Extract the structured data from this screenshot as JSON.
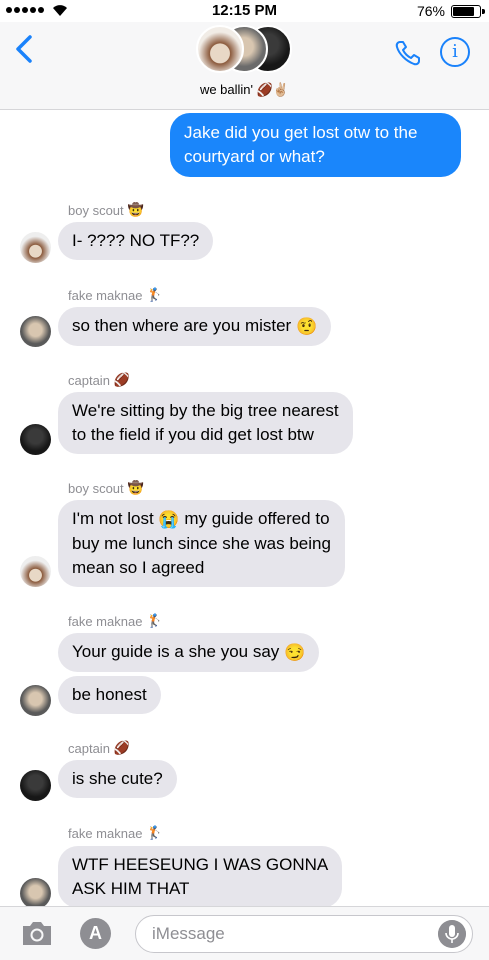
{
  "status_bar": {
    "time": "12:15 PM",
    "battery_pct": "76%",
    "battery_level": 0.76
  },
  "header": {
    "group_name": "we ballin'",
    "group_emoji": "🏈✌🏼"
  },
  "messages": [
    {
      "type": "sent",
      "text": "Jake did you get lost otw to the courtyard or what?"
    },
    {
      "type": "received",
      "sender": "boy scout",
      "sender_emoji": "🤠",
      "text": "I- ???? NO TF??"
    },
    {
      "type": "received",
      "sender": "fake maknae",
      "sender_emoji": "🏌",
      "text": "so then where are you mister",
      "emoji": "🤨"
    },
    {
      "type": "received",
      "sender": "captain",
      "sender_emoji": "🏈",
      "text_line1": "We're sitting by the big tree nearest",
      "text_line2": "to the field if you did get lost btw"
    },
    {
      "type": "received",
      "sender": "boy scout",
      "sender_emoji": "🤠",
      "text_line1a": "I'm not lost",
      "emoji": "😭",
      "text_line1b": "my guide offered to",
      "text_line2": "buy me lunch since she was being",
      "text_line3": "mean so I agreed"
    },
    {
      "type": "received",
      "sender": "fake maknae",
      "sender_emoji": "🏌",
      "text": "Your guide is a she you say",
      "emoji": "😏"
    },
    {
      "type": "received",
      "text": "be honest"
    },
    {
      "type": "received",
      "sender": "captain",
      "sender_emoji": "🏈",
      "text": "is she cute?"
    },
    {
      "type": "received",
      "sender": "fake maknae",
      "sender_emoji": "🏌",
      "text_line1": "WTF HEESEUNG I WAS GONNA",
      "text_line2": "ASK HIM THAT"
    }
  ],
  "input": {
    "placeholder": "iMessage"
  },
  "colors": {
    "accent": "#1a82fb",
    "sent_bubble": "#1a86fb",
    "received_bubble": "#e6e5eb"
  }
}
